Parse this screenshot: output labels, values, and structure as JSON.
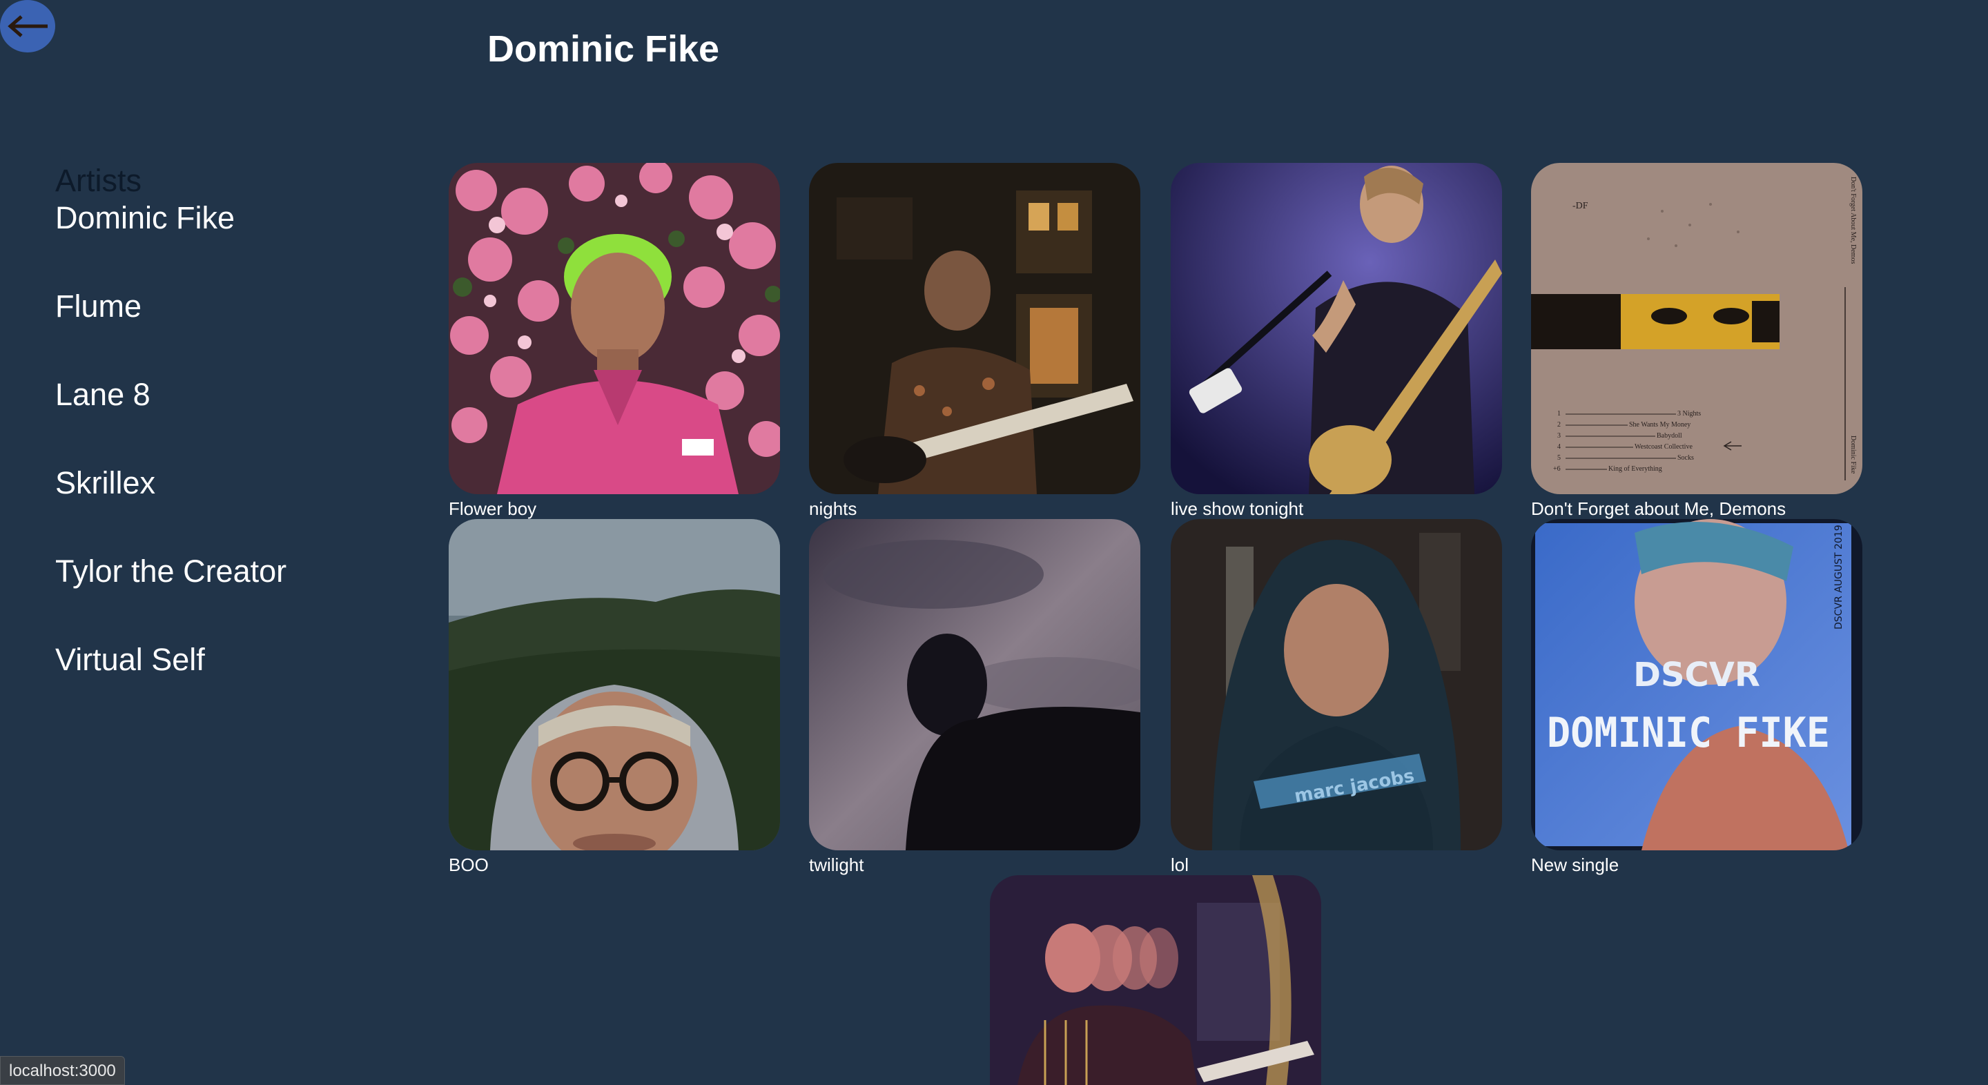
{
  "header": {
    "title": "Dominic Fike",
    "back_icon": "arrow-left-icon",
    "accent": "#3b63b3"
  },
  "sidebar": {
    "heading": "Artists",
    "items": [
      {
        "label": "Dominic Fike"
      },
      {
        "label": "Flume"
      },
      {
        "label": "Lane 8"
      },
      {
        "label": "Skrillex"
      },
      {
        "label": "Tylor the Creator"
      },
      {
        "label": "Virtual Self"
      }
    ]
  },
  "albums": [
    {
      "title": "Flower boy"
    },
    {
      "title": "nights"
    },
    {
      "title": "live show tonight"
    },
    {
      "title": "Don't Forget about Me, Demons"
    },
    {
      "title": "BOO"
    },
    {
      "title": "twilight"
    },
    {
      "title": "lol"
    },
    {
      "title": "New single"
    },
    {
      "title": ""
    }
  ],
  "album_art": {
    "dont_forget": {
      "initials": "-DF",
      "tracks": [
        {
          "num": "1",
          "name": "3 Nights"
        },
        {
          "num": "2",
          "name": "She Wants My Money"
        },
        {
          "num": "3",
          "name": "Babydoll"
        },
        {
          "num": "4",
          "name": "Westcoast Collective"
        },
        {
          "num": "5",
          "name": "Socks"
        },
        {
          "num": "+6",
          "name": "King of Everything"
        }
      ],
      "spine_text": "Don't Forget About Me, Demos",
      "spine_artist": "Dominic Fike"
    },
    "dscvr": {
      "line1": "DSCVR",
      "line2": "DOMINIC FIKE",
      "side_text": "DSCVR AUGUST 2019"
    },
    "hoodie_text": "marc jacobs"
  },
  "status_bar": {
    "url": "localhost:3000"
  },
  "colors": {
    "background": "#213449",
    "text": "#ffffff",
    "sidebar_heading": "#0d1a2a"
  }
}
